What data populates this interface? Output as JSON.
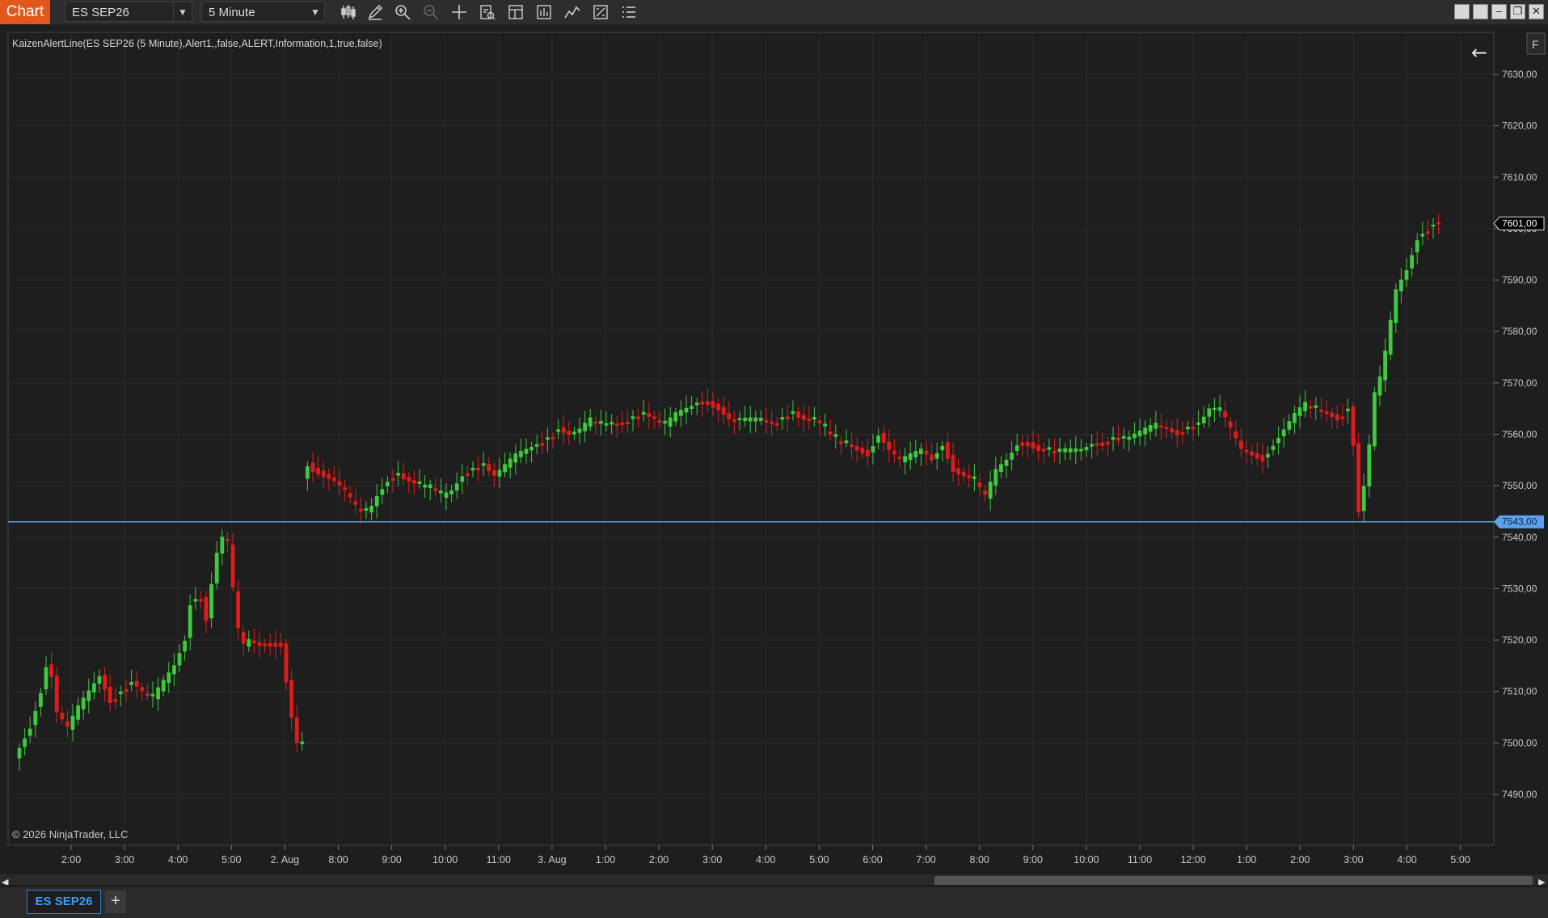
{
  "toolbar": {
    "chart_tab": "Chart",
    "instrument": "ES SEP26",
    "interval": "5 Minute",
    "icons": [
      "bars-type-icon",
      "pencil-draw-icon",
      "zoom-in-icon",
      "zoom-out-icon",
      "crosshair-icon",
      "properties-icon",
      "templates-icon",
      "indicators-icon",
      "strategies-icon",
      "data-box-icon",
      "menu-list-icon"
    ]
  },
  "window_buttons": [
    "restore-icon",
    "minimize-icon",
    "maximize-icon",
    "close-icon"
  ],
  "indicator_label": "KaizenAlertLine(ES SEP26 (5 Minute),Alert1,,false,ALERT,Information,1,true,false)",
  "copyright": "© 2026 NinjaTrader, LLC",
  "f_button": "F",
  "back_arrow": "←",
  "bottom_tabs": {
    "active": "ES SEP26",
    "add": "+"
  },
  "colors": {
    "up": "#3ec93e",
    "down": "#e31a1a",
    "alert_line": "#5ea2ef",
    "accent": "#e2581c"
  },
  "chart_data": {
    "type": "candlestick",
    "y_axis": {
      "min": 7482,
      "max": 7638,
      "ticks": [
        7490,
        7500,
        7510,
        7520,
        7530,
        7540,
        7550,
        7560,
        7570,
        7580,
        7590,
        7600,
        7610,
        7620,
        7630
      ],
      "tick_labels": [
        "7490,00",
        "7500,00",
        "7510,00",
        "7520,00",
        "7530,00",
        "7540,00",
        "7550,00",
        "7560,00",
        "7570,00",
        "7580,00",
        "7590,00",
        "7600,00",
        "7610,00",
        "7620,00",
        "7630,00"
      ]
    },
    "x_axis": {
      "labels": [
        "2:00",
        "3:00",
        "4:00",
        "5:00",
        "2. Aug",
        "8:00",
        "9:00",
        "10:00",
        "11:00",
        "3. Aug",
        "1:00",
        "2:00",
        "3:00",
        "4:00",
        "5:00",
        "6:00",
        "7:00",
        "8:00",
        "9:00",
        "10:00",
        "11:00",
        "12:00",
        "1:00",
        "2:00",
        "3:00",
        "4:00",
        "5:00"
      ]
    },
    "alert_line": {
      "value": 7543,
      "label": "7543,00"
    },
    "last_price": {
      "value": 7601,
      "label": "7601,00"
    },
    "segments": [
      {
        "path": [
          [
            0,
            7497
          ],
          [
            3,
            7503
          ],
          [
            5,
            7510
          ],
          [
            6,
            7515
          ],
          [
            7,
            7513
          ],
          [
            8,
            7506
          ],
          [
            10,
            7503
          ],
          [
            12,
            7507
          ],
          [
            14,
            7510
          ],
          [
            16,
            7513
          ],
          [
            18,
            7508
          ],
          [
            20,
            7510
          ],
          [
            22,
            7512
          ],
          [
            24,
            7510
          ],
          [
            26,
            7509
          ],
          [
            28,
            7512
          ],
          [
            30,
            7515
          ],
          [
            32,
            7520
          ],
          [
            33,
            7527
          ],
          [
            35,
            7528
          ],
          [
            36,
            7524
          ],
          [
            37,
            7531
          ],
          [
            38,
            7537
          ],
          [
            39,
            7540
          ],
          [
            40,
            7539
          ],
          [
            41,
            7530
          ],
          [
            42,
            7522
          ],
          [
            43,
            7519
          ],
          [
            44,
            7520
          ],
          [
            46,
            7519
          ],
          [
            48,
            7519
          ],
          [
            50,
            7519
          ],
          [
            51,
            7512
          ],
          [
            52,
            7505
          ],
          [
            53,
            7500
          ]
        ]
      },
      {
        "path": [
          [
            54,
            7551
          ],
          [
            55,
            7554
          ],
          [
            56,
            7553
          ],
          [
            58,
            7552
          ],
          [
            60,
            7551
          ],
          [
            62,
            7549
          ],
          [
            64,
            7546
          ],
          [
            66,
            7545
          ],
          [
            67,
            7546
          ],
          [
            68,
            7548
          ],
          [
            70,
            7551
          ],
          [
            72,
            7552
          ],
          [
            74,
            7551
          ],
          [
            76,
            7550
          ],
          [
            78,
            7550
          ],
          [
            80,
            7548
          ],
          [
            82,
            7549
          ],
          [
            84,
            7552
          ],
          [
            86,
            7553
          ],
          [
            88,
            7554
          ],
          [
            90,
            7552
          ],
          [
            92,
            7554
          ],
          [
            94,
            7556
          ],
          [
            96,
            7557
          ],
          [
            98,
            7558
          ],
          [
            100,
            7559
          ],
          [
            102,
            7561
          ],
          [
            104,
            7560
          ],
          [
            106,
            7561
          ],
          [
            108,
            7563
          ],
          [
            110,
            7562
          ],
          [
            112,
            7562
          ],
          [
            114,
            7562
          ],
          [
            116,
            7563
          ],
          [
            118,
            7564
          ],
          [
            120,
            7563
          ],
          [
            122,
            7562
          ],
          [
            124,
            7564
          ],
          [
            126,
            7565
          ],
          [
            128,
            7566
          ],
          [
            130,
            7566
          ],
          [
            132,
            7565
          ],
          [
            134,
            7563
          ],
          [
            136,
            7563
          ],
          [
            138,
            7563
          ],
          [
            140,
            7563
          ],
          [
            142,
            7562
          ],
          [
            144,
            7563
          ],
          [
            146,
            7564
          ],
          [
            148,
            7563
          ],
          [
            150,
            7563
          ],
          [
            152,
            7561
          ],
          [
            154,
            7559
          ],
          [
            156,
            7558
          ],
          [
            158,
            7557
          ],
          [
            160,
            7556
          ],
          [
            162,
            7560
          ],
          [
            164,
            7557
          ],
          [
            166,
            7555
          ],
          [
            168,
            7556
          ],
          [
            170,
            7557
          ],
          [
            172,
            7555
          ],
          [
            174,
            7558
          ],
          [
            176,
            7553
          ],
          [
            178,
            7552
          ],
          [
            180,
            7551
          ],
          [
            182,
            7548
          ],
          [
            184,
            7553
          ],
          [
            186,
            7555
          ],
          [
            188,
            7558
          ],
          [
            190,
            7558
          ],
          [
            192,
            7557
          ],
          [
            194,
            7557
          ],
          [
            196,
            7557
          ],
          [
            198,
            7557
          ],
          [
            200,
            7557
          ],
          [
            202,
            7558
          ],
          [
            204,
            7558
          ],
          [
            206,
            7559
          ],
          [
            208,
            7559
          ],
          [
            210,
            7560
          ],
          [
            212,
            7561
          ],
          [
            214,
            7562
          ],
          [
            216,
            7561
          ],
          [
            218,
            7560
          ],
          [
            220,
            7561
          ],
          [
            222,
            7562
          ],
          [
            224,
            7565
          ],
          [
            226,
            7565
          ],
          [
            228,
            7561
          ],
          [
            230,
            7557
          ],
          [
            232,
            7556
          ],
          [
            234,
            7555
          ],
          [
            236,
            7558
          ],
          [
            238,
            7561
          ],
          [
            240,
            7564
          ],
          [
            242,
            7566
          ],
          [
            244,
            7565
          ],
          [
            246,
            7564
          ],
          [
            248,
            7563
          ],
          [
            250,
            7565
          ],
          [
            251,
            7558
          ],
          [
            252,
            7545
          ],
          [
            253,
            7550
          ],
          [
            254,
            7558
          ],
          [
            255,
            7568
          ],
          [
            256,
            7571
          ],
          [
            257,
            7576
          ],
          [
            258,
            7582
          ],
          [
            259,
            7588
          ],
          [
            260,
            7590
          ],
          [
            261,
            7592
          ],
          [
            262,
            7595
          ],
          [
            263,
            7598
          ],
          [
            264,
            7599
          ],
          [
            265,
            7600
          ],
          [
            266,
            7601
          ]
        ]
      }
    ]
  }
}
